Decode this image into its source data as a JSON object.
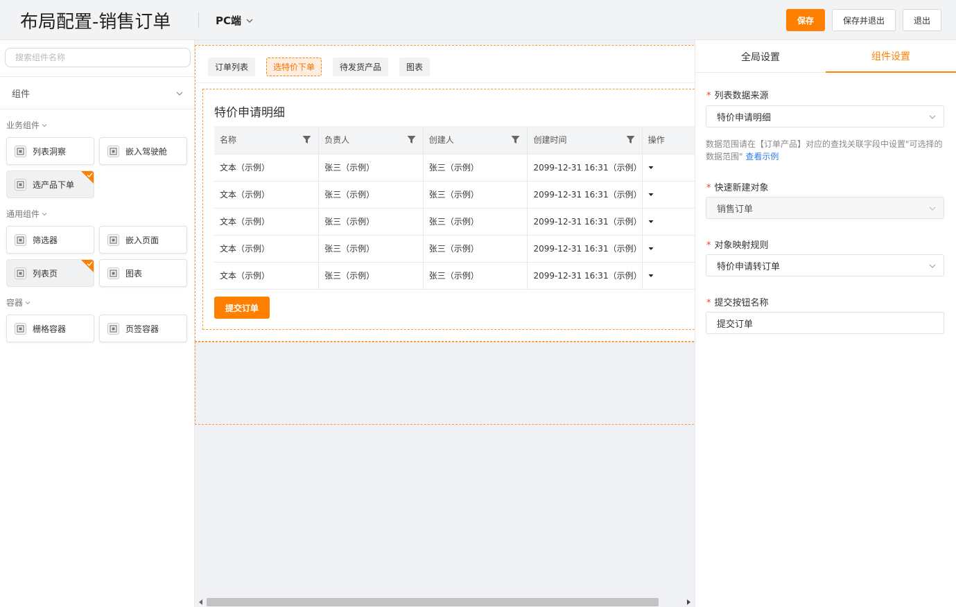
{
  "header": {
    "title": "布局配置-销售订单",
    "device": "PC端",
    "save_label": "保存",
    "save_exit_label": "保存并退出",
    "exit_label": "退出"
  },
  "left_panel": {
    "search_placeholder": "搜索组件名称",
    "component_type": "组件",
    "groups": [
      {
        "label": "业务组件",
        "items": [
          "列表洞察",
          "嵌入驾驶舱",
          "选产品下单"
        ]
      },
      {
        "label": "通用组件",
        "items": [
          "筛选器",
          "嵌入页面",
          "列表页",
          "图表"
        ]
      },
      {
        "label": "容器",
        "items": [
          "栅格容器",
          "页签容器"
        ]
      }
    ]
  },
  "canvas": {
    "tabs": [
      "订单列表",
      "选特价下单",
      "待发货产品",
      "图表"
    ],
    "active_tab": "选特价下单",
    "table_title": "特价申请明细",
    "columns": [
      "名称",
      "负责人",
      "创建人",
      "创建时间",
      "操作"
    ],
    "rows": [
      [
        "文本（示例）",
        "张三（示例）",
        "张三（示例）",
        "2099-12-31 16:31（示例）"
      ],
      [
        "文本（示例）",
        "张三（示例）",
        "张三（示例）",
        "2099-12-31 16:31（示例）"
      ],
      [
        "文本（示例）",
        "张三（示例）",
        "张三（示例）",
        "2099-12-31 16:31（示例）"
      ],
      [
        "文本（示例）",
        "张三（示例）",
        "张三（示例）",
        "2099-12-31 16:31（示例）"
      ],
      [
        "文本（示例）",
        "张三（示例）",
        "张三（示例）",
        "2099-12-31 16:31（示例）"
      ]
    ],
    "submit_label": "提交订单"
  },
  "right_panel": {
    "tabs": [
      "全局设置",
      "组件设置"
    ],
    "active_tab": "组件设置",
    "fields": {
      "data_source": {
        "label": "列表数据来源",
        "value": "特价申请明细"
      },
      "hint_text": "数据范围请在【订单产品】对应的查找关联字段中设置\"可选择的数据范围\"",
      "hint_link": "查看示例",
      "quick_create": {
        "label": "快速新建对象",
        "value": "销售订单"
      },
      "mapping_rule": {
        "label": "对象映射规则",
        "value": "特价申请转订单"
      },
      "button_name": {
        "label": "提交按钮名称",
        "value": "提交订单"
      }
    }
  },
  "colors": {
    "accent": "#ff8000",
    "link": "#2f7ce9",
    "required": "#f04134"
  }
}
